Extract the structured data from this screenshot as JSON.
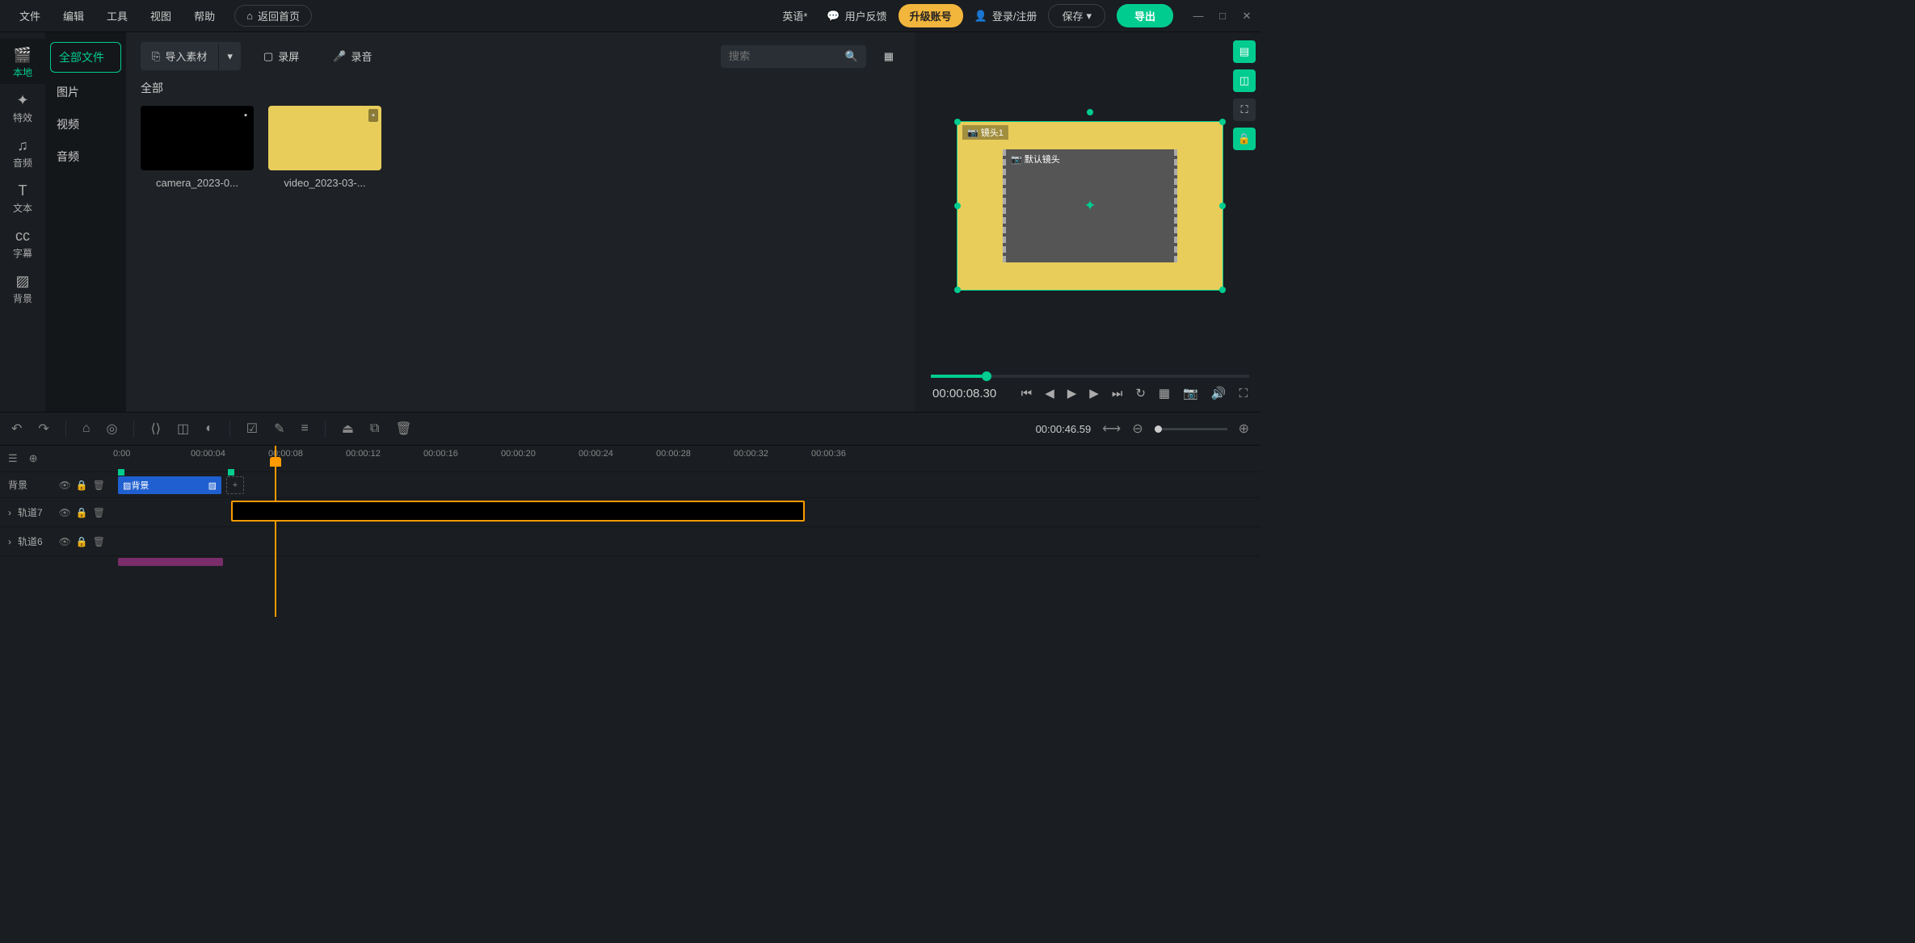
{
  "menu": {
    "file": "文件",
    "edit": "编辑",
    "tool": "工具",
    "view": "视图",
    "help": "帮助",
    "home": "返回首页"
  },
  "header": {
    "docTitle": "英语*",
    "feedback": "用户反馈",
    "upgrade": "升级账号",
    "login": "登录/注册",
    "save": "保存",
    "export": "导出"
  },
  "leftnav": [
    {
      "icon": "🎬",
      "label": "本地",
      "active": true
    },
    {
      "icon": "✦",
      "label": "特效"
    },
    {
      "icon": "♫",
      "label": "音频"
    },
    {
      "icon": "T",
      "label": "文本"
    },
    {
      "icon": "cc",
      "label": "字幕"
    },
    {
      "icon": "▨",
      "label": "背景"
    }
  ],
  "filecol": {
    "all": "全部文件",
    "image": "图片",
    "video": "视频",
    "audio": "音频"
  },
  "media": {
    "import": "导入素材",
    "record": "录屏",
    "recordAudio": "录音",
    "searchPlaceholder": "搜索",
    "sectionAll": "全部",
    "items": [
      {
        "name": "camera_2023-0...",
        "type": "black"
      },
      {
        "name": "video_2023-03-...",
        "type": "yellow"
      }
    ]
  },
  "preview": {
    "shotLabel": "镜头1",
    "defaultShot": "默认镜头",
    "time": "00:00:08.30"
  },
  "toolbar": {
    "time": "00:00:46.59"
  },
  "ruler": [
    "0:00",
    "00:00:04",
    "00:00:08",
    "00:00:12",
    "00:00:16",
    "00:00:20",
    "00:00:24",
    "00:00:28",
    "00:00:32",
    "00:00:36"
  ],
  "tracks": {
    "bg": "背景",
    "bgClip": "背景",
    "t7": "轨道7",
    "t6": "轨道6"
  }
}
